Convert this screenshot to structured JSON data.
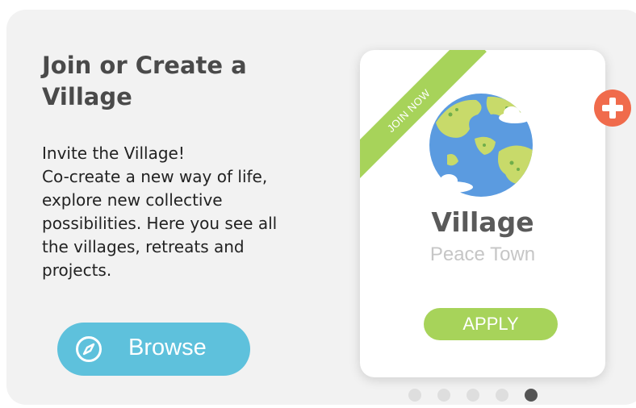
{
  "intro": {
    "title": "Join or Create a Village",
    "description": "Invite the Village!\nCo-create a new way of life, explore new collective possibilities. Here you see all the villages, retreats and projects.",
    "browse_label": "Browse",
    "browse_icon": "compass-icon"
  },
  "card": {
    "ribbon": "JOIN NOW",
    "image_icon": "globe-icon",
    "name": "Village",
    "subtitle": "Peace Town",
    "apply_label": "APPLY"
  },
  "add_button_icon": "plus-icon",
  "pagination": {
    "total": 5,
    "active_index": 4
  },
  "colors": {
    "accent_green": "#a7d35a",
    "browse_blue": "#5ec1dc",
    "add_orange": "#f06b4c",
    "panel": "#f2f2f2"
  }
}
